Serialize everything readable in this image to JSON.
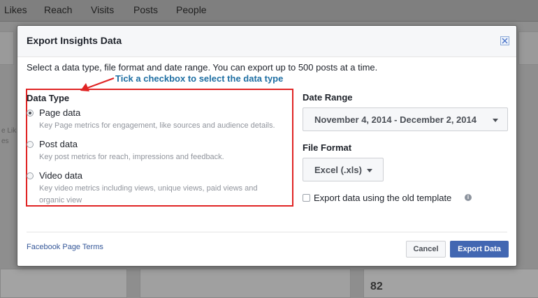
{
  "background": {
    "tabs": [
      "Likes",
      "Reach",
      "Visits",
      "Posts",
      "People"
    ],
    "left_snippets": [
      "e Lik",
      "es"
    ],
    "stat_value": "82"
  },
  "modal": {
    "title": "Export Insights Data",
    "intro": "Select a data type, file format and date range. You can export up to 500 posts at a time.",
    "annotation": "Tick a checkbox to select the data type",
    "data_type": {
      "label": "Data Type",
      "options": [
        {
          "label": "Page data",
          "description": "Key Page metrics for engagement, like sources and audience details.",
          "selected": true
        },
        {
          "label": "Post data",
          "description": "Key post metrics for reach, impressions and feedback.",
          "selected": false
        },
        {
          "label": "Video data",
          "description": "Key video metrics including views, unique views, paid views and organic view",
          "selected": false
        }
      ]
    },
    "date_range": {
      "label": "Date Range",
      "value": "November 4, 2014 - December 2, 2014"
    },
    "file_format": {
      "label": "File Format",
      "value": "Excel (.xls)"
    },
    "old_template": {
      "label": "Export data using the old template",
      "checked": false
    },
    "terms_link": "Facebook Page Terms",
    "buttons": {
      "cancel": "Cancel",
      "export": "Export Data"
    }
  },
  "colors": {
    "annotation_box": "#e02424",
    "annotation_text": "#1f6fa3",
    "primary_button": "#4267b2",
    "link": "#365899"
  },
  "icons": [
    "close-icon",
    "caret-down-icon",
    "info-icon",
    "annotation-arrow-icon"
  ]
}
